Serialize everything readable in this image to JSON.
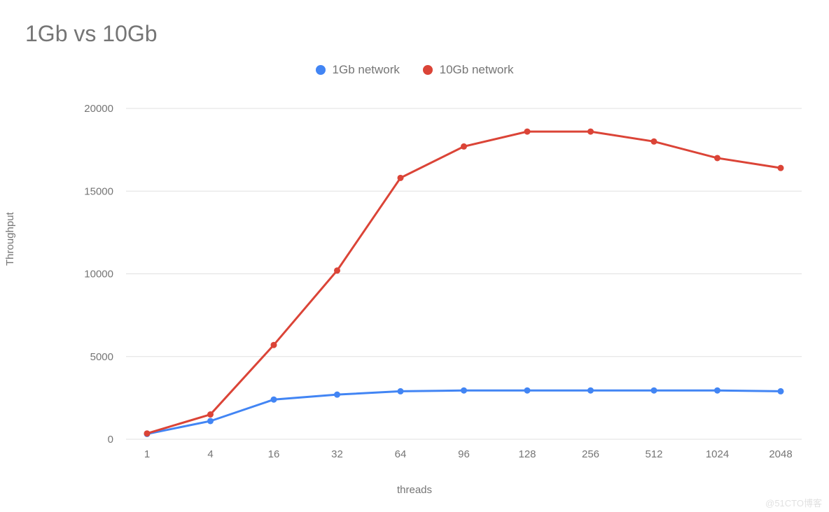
{
  "chart_data": {
    "type": "line",
    "title": "1Gb vs 10Gb",
    "xlabel": "threads",
    "ylabel": "Throughput",
    "categories": [
      "1",
      "4",
      "16",
      "32",
      "64",
      "96",
      "128",
      "256",
      "512",
      "1024",
      "2048"
    ],
    "ylim": [
      0,
      20000
    ],
    "yticks": [
      0,
      5000,
      10000,
      15000,
      20000
    ],
    "series": [
      {
        "name": "1Gb network",
        "color": "#4285F4",
        "values": [
          320,
          1100,
          2400,
          2700,
          2900,
          2950,
          2950,
          2950,
          2950,
          2950,
          2900
        ]
      },
      {
        "name": "10Gb network",
        "color": "#DB4437",
        "values": [
          350,
          1500,
          5700,
          10200,
          15800,
          17700,
          18600,
          18600,
          18000,
          17000,
          16400
        ]
      }
    ]
  },
  "watermark": "@51CTO博客"
}
